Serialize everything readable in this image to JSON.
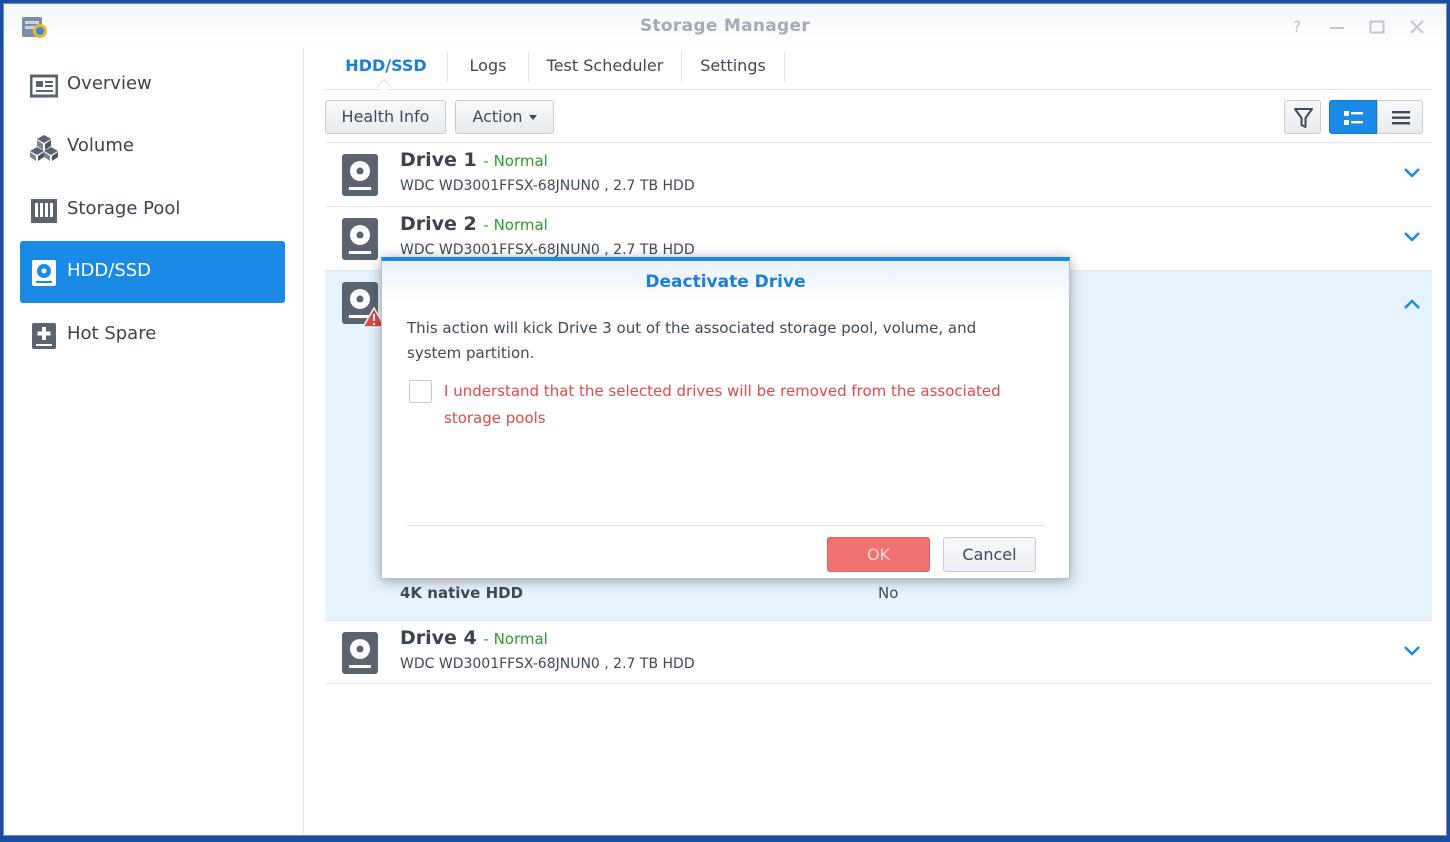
{
  "window": {
    "title": "Storage Manager",
    "controls": [
      "help-icon",
      "minimize-icon",
      "maximize-icon",
      "close-icon"
    ]
  },
  "sidebar": {
    "items": [
      {
        "label": "Overview",
        "icon": "overview-icon",
        "active": false
      },
      {
        "label": "Volume",
        "icon": "volume-icon",
        "active": false
      },
      {
        "label": "Storage Pool",
        "icon": "storage-pool-icon",
        "active": false
      },
      {
        "label": "HDD/SSD",
        "icon": "hdd-icon",
        "active": true
      },
      {
        "label": "Hot Spare",
        "icon": "hot-spare-icon",
        "active": false
      }
    ]
  },
  "tabs": [
    {
      "label": "HDD/SSD",
      "active": true
    },
    {
      "label": "Logs",
      "active": false
    },
    {
      "label": "Test Scheduler",
      "active": false
    },
    {
      "label": "Settings",
      "active": false
    }
  ],
  "toolbar": {
    "health_info": "Health Info",
    "action": "Action",
    "view_icons": [
      "filter-icon",
      "list-detail-view-icon",
      "list-view-icon"
    ],
    "active_view": "list-detail-view-icon"
  },
  "drives": [
    {
      "name": "Drive 1",
      "status": "Normal",
      "desc": "WDC WD3001FFSX-68JNUN0 , 2.7 TB HDD"
    },
    {
      "name": "Drive 2",
      "status": "Normal",
      "desc": "WDC WD3001FFSX-68JNUN0 , 2.7 TB HDD"
    },
    {
      "name": "Drive 4",
      "status": "Normal",
      "desc": "WDC WD3001FFSX-68JNUN0 , 2.7 TB HDD"
    }
  ],
  "expanded_drive": {
    "warning_icon": "warning-icon",
    "detail_label": "4K native HDD",
    "detail_value": "No"
  },
  "dialog": {
    "title": "Deactivate Drive",
    "message": "This action will kick Drive 3 out of the associated storage pool, volume, and system partition.",
    "checkbox_label": "I understand that the selected drives will be removed from the associated storage pools",
    "checkbox_checked": false,
    "ok_label": "OK",
    "cancel_label": "Cancel"
  },
  "colors": {
    "accent": "#1a8ae6",
    "status_normal": "#2f9a2f",
    "warning": "#e04b4b"
  }
}
